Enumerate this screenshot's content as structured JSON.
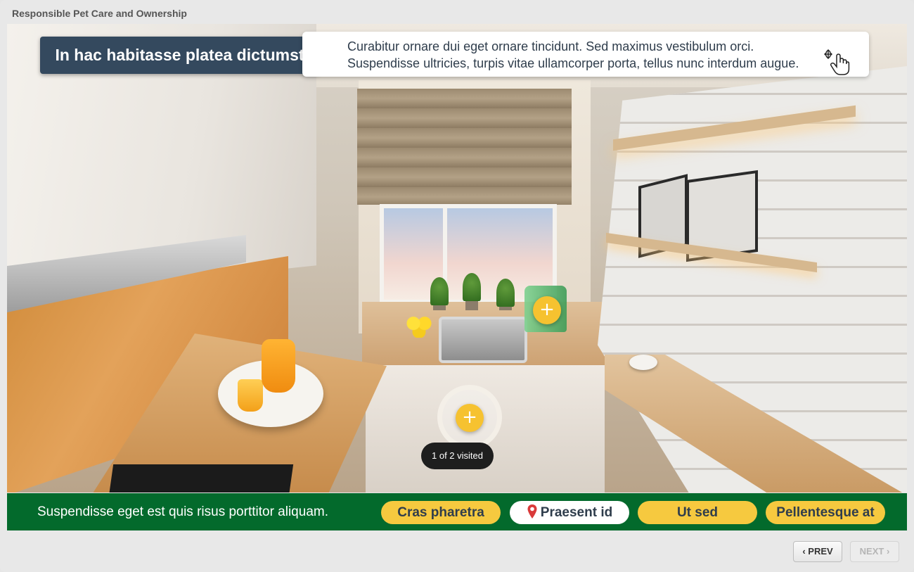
{
  "app": {
    "title": "Responsible Pet Care and Ownership"
  },
  "scene": {
    "heading": "In hac habitasse platea dictumst",
    "description": [
      "Curabitur ornare dui eget ornare tincidunt. Sed maximus vestibulum orci.",
      "Suspendisse ultricies, turpis vitae ullamcorper porta, tellus nunc interdum augue."
    ],
    "hotspot_icon": "plus-icon",
    "hotspot_symbol": "+",
    "visited_label": "1 of 2 visited",
    "drag_cursor_icon": "hand-drag-icon"
  },
  "nav_bar": {
    "caption": "Suspendisse eget est quis risus porttitor aliquam.",
    "locations": [
      {
        "label": "Cras pharetra",
        "active": false
      },
      {
        "label": "Praesent id",
        "active": true,
        "icon": "map-pin-icon"
      },
      {
        "label": "Ut sed",
        "active": false
      },
      {
        "label": "Pellentesque at",
        "active": false
      }
    ]
  },
  "footer": {
    "prev_label": "PREV",
    "next_label": "NEXT",
    "prev_icon": "chevron-left-icon",
    "next_icon": "chevron-right-icon",
    "next_disabled": true
  },
  "colors": {
    "heading_bg": "#34495e",
    "nav_bar_bg": "#036a2c",
    "pill_yellow": "#f6c93f",
    "hotspot_yellow": "#f6c230",
    "pin_red": "#d93a3a"
  }
}
